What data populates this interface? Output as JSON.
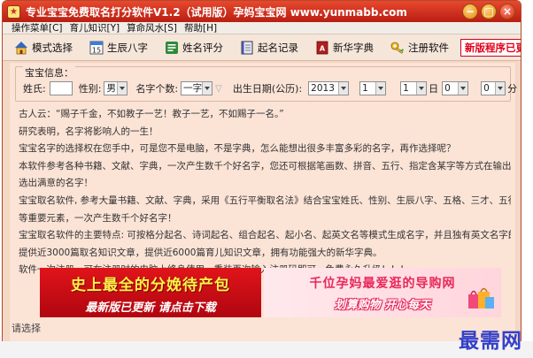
{
  "window": {
    "title": "专业宝宝免费取名打分软件V1.2（试用版）孕妈宝宝网 www.yunmabb.com",
    "icon": "star-app-icon"
  },
  "menu": [
    {
      "label": "操作菜单[C]"
    },
    {
      "label": "育儿知识[Y]"
    },
    {
      "label": "算命风水[S]"
    },
    {
      "label": "帮助[H]"
    }
  ],
  "toolbar": {
    "mode_select": "模式选择",
    "birth_chars": "生辰八字",
    "name_score": "姓名评分",
    "name_record": "起名记录",
    "xinhua_dict": "新华字典",
    "register": "注册软件",
    "update_notice": "新版程序已更新 点击下载"
  },
  "form": {
    "legend": "宝宝信息：",
    "surname_label": "姓氏:",
    "surname_value": "",
    "gender_label": "性别:",
    "gender_value": "男",
    "name_chars_label": "名字个数:",
    "name_chars_value": "一字",
    "birth_label": "出生日期(公历):",
    "year_value": "2013",
    "month_value": "1",
    "day_value": "1",
    "day_label": "日",
    "hour_value": "0",
    "minute_value": "0",
    "minute_label": "分"
  },
  "intro": [
    "古人云：“赐子千金，不如教子一艺！教子一艺，不如赐子一名。”",
    "研究表明，名字将影响人的一生！",
    "宝宝名字的选择权在您手中，可是您不是电脑，不是字典，怎么能想出很多丰富多彩的名字，再作选择呢？",
    "本软件参考各种书籍、文献、字典，一次产生数千个好名字，您还可根据笔画数、拼音、五行、指定含某字等方式在输出结果里筛",
    "选出满意的名字！",
    "宝宝取名软件, 参考大量书籍、文献、字典，采用《五行平衡取名法》结合宝宝姓氏、性别、生辰八字、五格、三才、五行及音行意",
    "等重要元素，一次产生数千个好名字！",
    "宝宝取名软件的主要特点: 可按格分起名、诗词起名、组合起名、起小名、起英文名等模式生成名字，并且独有英文名字朗读功能。",
    "提供近3000篇取名知识文章，提供近6000篇育儿知识文章，拥有功能强大的新华字典。",
    "软件一次注册，可在注册时的电脑上终身使用，重装再次输入注册码即可，免费永久升级！！！"
  ],
  "banner_left": {
    "title": "史上最全的分娩待产包",
    "subtitle": "最新版已更新 请点击下载"
  },
  "banner_right": {
    "title": "千位孕妈最爱逛的导购网",
    "subtitle": "划算购物 开心每天"
  },
  "cut_line": "请选择"
}
